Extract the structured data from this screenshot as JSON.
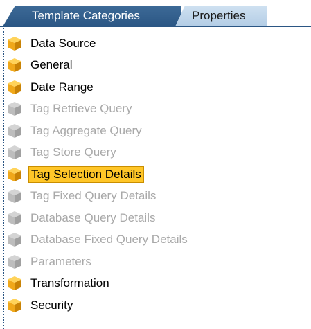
{
  "tabs": {
    "active_label": "Template Categories",
    "inactive_label": "Properties"
  },
  "colors": {
    "tab_active_bg": "#2b5684",
    "tab_inactive_bg": "#c4d9ec",
    "selection_bg": "#ffc628",
    "enabled_icon": "#f2b319",
    "disabled_icon": "#b8b8b8",
    "disabled_text": "#a9a9a9"
  },
  "tree": {
    "items": [
      {
        "label": "Data Source",
        "state": "enabled",
        "icon": "cube-icon"
      },
      {
        "label": "General",
        "state": "enabled",
        "icon": "cube-icon"
      },
      {
        "label": "Date Range",
        "state": "enabled",
        "icon": "cube-icon"
      },
      {
        "label": "Tag Retrieve Query",
        "state": "disabled",
        "icon": "cube-icon"
      },
      {
        "label": "Tag Aggregate Query",
        "state": "disabled",
        "icon": "cube-icon"
      },
      {
        "label": "Tag Store Query",
        "state": "disabled",
        "icon": "cube-icon"
      },
      {
        "label": "Tag Selection Details",
        "state": "selected",
        "icon": "cube-icon"
      },
      {
        "label": "Tag Fixed Query Details",
        "state": "disabled",
        "icon": "cube-icon"
      },
      {
        "label": "Database Query Details",
        "state": "disabled",
        "icon": "cube-icon"
      },
      {
        "label": "Database Fixed Query Details",
        "state": "disabled",
        "icon": "cube-icon"
      },
      {
        "label": "Parameters",
        "state": "disabled",
        "icon": "cube-icon"
      },
      {
        "label": "Transformation",
        "state": "enabled",
        "icon": "cube-icon"
      },
      {
        "label": "Security",
        "state": "enabled",
        "icon": "cube-icon"
      }
    ]
  }
}
